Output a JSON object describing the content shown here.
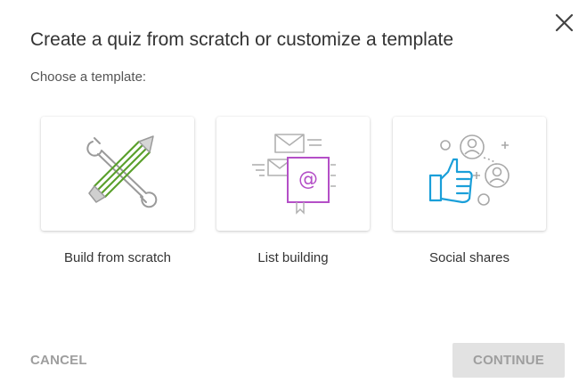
{
  "dialog": {
    "title": "Create a quiz from scratch or customize a template",
    "subtitle": "Choose a template:",
    "close_icon": "close-icon"
  },
  "templates": [
    {
      "label": "Build from scratch",
      "icon": "wrench-pencil-icon"
    },
    {
      "label": "List building",
      "icon": "email-address-book-icon"
    },
    {
      "label": "Social shares",
      "icon": "thumbs-up-people-icon"
    }
  ],
  "footer": {
    "cancel_label": "CANCEL",
    "continue_label": "CONTINUE",
    "continue_enabled": false
  },
  "colors": {
    "accent_green": "#5aa02c",
    "accent_purple": "#b44fc7",
    "accent_blue": "#1a9fd9",
    "icon_gray": "#b0b0b0"
  }
}
